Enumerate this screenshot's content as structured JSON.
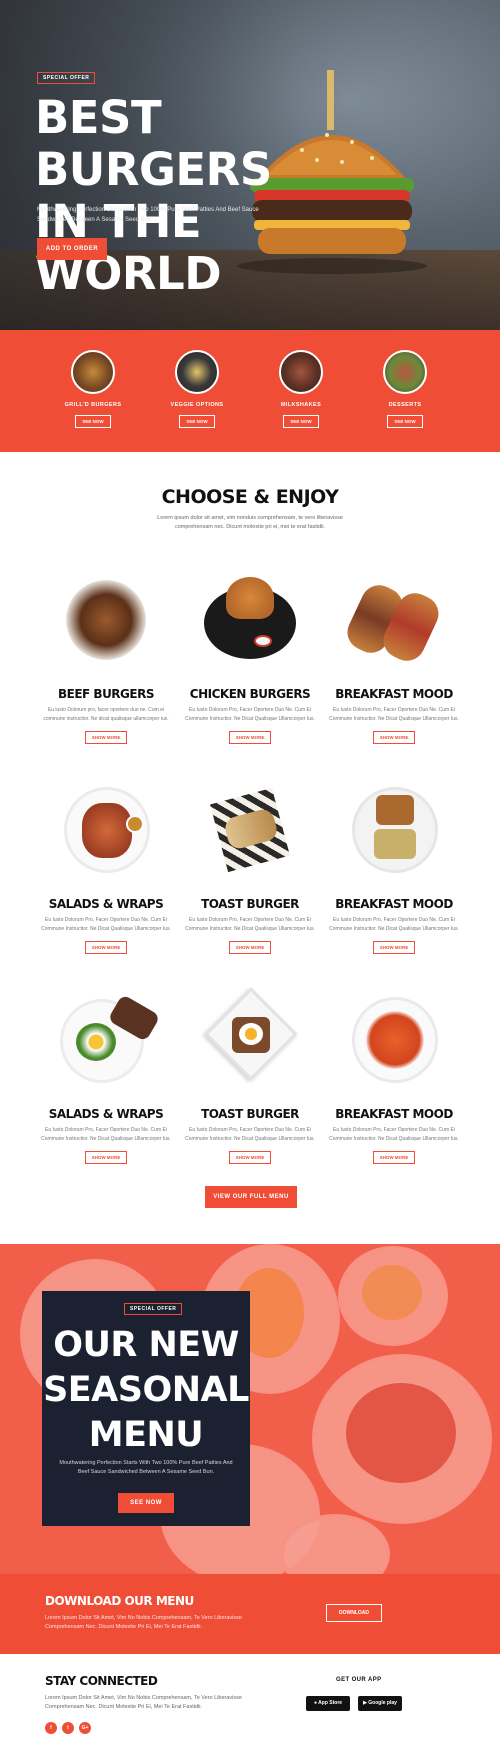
{
  "hero": {
    "badge": "SPECIAL OFFER",
    "title_line1": "BEST BURGERS",
    "title_line2": "IN THE WORLD",
    "subtitle": "Mouthwatering Perfection Starts With Two 100% Pure Beef Patties And Beef Sauce Sandwiched Between A Sesame Seed Bun.",
    "cta": "ADD TO ORDER"
  },
  "categories": [
    {
      "label": "GRILL'D BURGERS",
      "button": "SEE NOW"
    },
    {
      "label": "VEGGIE OPTIONS",
      "button": "SEE NOW"
    },
    {
      "label": "MILKSHAKES",
      "button": "SEE NOW"
    },
    {
      "label": "DESSERTS",
      "button": "SEE NOW"
    }
  ],
  "menu": {
    "title": "CHOOSE & ENJOY",
    "subtitle": "Lorem ipsum dolor sit amet, vim nonduis comprehensam, te vero liberavisse comprehensam nec. Dicunt molestie pri ei, mei te erat fastidii.",
    "items": [
      {
        "name": "BEEF BURGERS",
        "desc": "Eu iusto Dolorum pro, facer oportere duo ne. Cum ei commune instructior. Ne dicat qualisque ullamcorper ius.",
        "button": "SHOW MORE"
      },
      {
        "name": "CHICKEN BURGERS",
        "desc": "Eu Iusto Dolorum Pro, Facer Oportere Duo Ne. Cum Ei Commune Instructior. Ne Dicat Qualisque Ullamcorper Ius.",
        "button": "SHOW MORE"
      },
      {
        "name": "BREAKFAST MOOD",
        "desc": "Eu Iusto Dolorum Pro, Facer Oportere Duo Ne. Cum Ei Commune Instructior. Ne Dicat Qualisque Ullamcorper Ius.",
        "button": "SHOW MORE"
      },
      {
        "name": "SALADS & WRAPS",
        "desc": "Eu Iusto Dolorum Pro, Facer Oportere Duo Ne. Cum Ei Commune Instructior. Ne Dicat Qualisque Ullamcorper Ius.",
        "button": "SHOW MORE"
      },
      {
        "name": "TOAST BURGER",
        "desc": "Eu Iusto Dolorum Pro, Facer Oportere Duo Ne. Cum Ei Commune Instructior. Ne Dicat Qualisque Ullamcorper Ius.",
        "button": "SHOW MORE"
      },
      {
        "name": "BREAKFAST MOOD",
        "desc": "Eu Iusto Dolorum Pro, Facer Oportere Duo Ne. Cum Ei Commune Instructior. Ne Dicat Qualisque Ullamcorper Ius.",
        "button": "SHOW MORE"
      },
      {
        "name": "SALADS & WRAPS",
        "desc": "Eu Iusto Dolorum Pro, Facer Oportere Duo Ne. Cum Ei Commune Instructior. Ne Dicat Qualisque Ullamcorper Ius.",
        "button": "SHOW MORE"
      },
      {
        "name": "TOAST BURGER",
        "desc": "Eu Iusto Dolorum Pro, Facer Oportere Duo Ne. Cum Ei Commune Instructior. Ne Dicat Qualisque Ullamcorper Ius.",
        "button": "SHOW MORE"
      },
      {
        "name": "BREAKFAST MOOD",
        "desc": "Eu Iusto Dolorum Pro, Facer Oportere Duo Ne. Cum Ei Commune Instructior. Ne Dicat Qualisque Ullamcorper Ius.",
        "button": "SHOW MORE"
      }
    ],
    "view_full": "VIEW OUR FULL MENU"
  },
  "seasonal": {
    "badge": "SPECIAL OFFER",
    "title_line1": "OUR NEW",
    "title_line2": "SEASONAL",
    "title_line3": "MENU",
    "subtitle": "Mouthwatering Perfection Starts With Two 100% Pure Beef Patties And Beef Sauce Sandwiched Between A Sesame Seed Bun.",
    "cta": "SEE NOW"
  },
  "download": {
    "title": "DOWNLOAD OUR MENU",
    "subtitle": "Lorem Ipsum Dolor Sit Amet, Vim No Nobis Comprehensam, Te Vero Liberavisse Comprehensam Nec. Dicunt Molestie Pri Ei, Mei Te Erat Fastidii.",
    "button": "DOWNLOAD"
  },
  "footer": {
    "title": "STAY CONNECTED",
    "subtitle": "Lorem Ipsum Dolor Sit Amet, Vim No Nobis Comprehensam, Te Vero Liberavisse Comprehensam Nec. Dicunt Molestie Pri Ei, Mei Te Erat Fastidii.",
    "social": [
      "f",
      "t",
      "G+"
    ],
    "app_title": "GET OUR APP",
    "app_store": "App Store",
    "google_play": "Google play"
  },
  "colors": {
    "accent": "#f04d37",
    "dark": "#1b2130"
  },
  "icons": [
    "facebook-icon",
    "twitter-icon",
    "google-plus-icon",
    "apple-icon",
    "google-play-icon"
  ]
}
